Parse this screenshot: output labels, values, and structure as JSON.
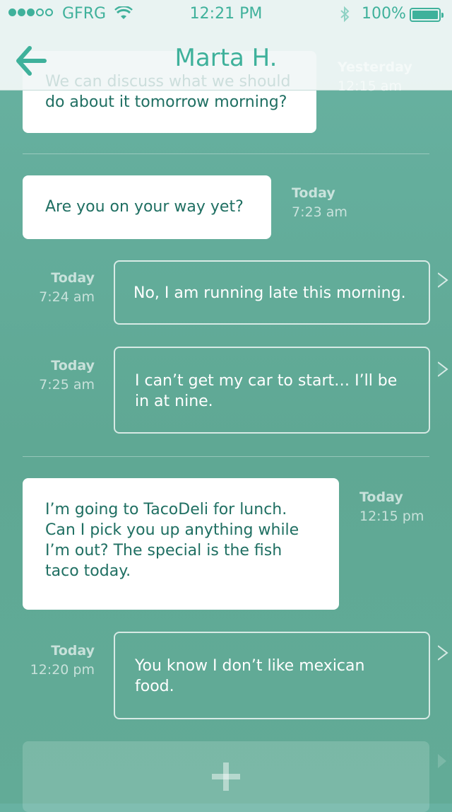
{
  "status_bar": {
    "carrier": "GFRG",
    "time": "12:21 PM",
    "battery": "100%",
    "signal_bars_filled": 3,
    "signal_bars_total": 5
  },
  "header": {
    "title": "Marta H.",
    "back_icon": "back-arrow-icon"
  },
  "colors": {
    "accent": "#3fb19b",
    "background": "#64ad9a",
    "bubble_in": "#ffffff",
    "text_dark": "#1f6f62"
  },
  "messages": [
    {
      "direction": "in",
      "text_line1": "We can discuss what we should",
      "text_line2": "do about it tomorrow morning?",
      "date": "Yesterday",
      "time": "12:15 am"
    },
    {
      "direction": "in",
      "text": "Are you on your way yet?",
      "date": "Today",
      "time": "7:23 am"
    },
    {
      "direction": "out",
      "text": "No, I am running late this morning.",
      "date": "Today",
      "time": "7:24 am"
    },
    {
      "direction": "out",
      "text": "I can’t get my car to start… I’ll be in at nine.",
      "date": "Today",
      "time": "7:25 am"
    },
    {
      "direction": "in",
      "text": "I’m going to TacoDeli for lunch. Can I pick you up anything while I’m out?  The special is the fish taco today.",
      "date": "Today",
      "time": "12:15 pm"
    },
    {
      "direction": "out",
      "text": "You know I don’t like mexican food.",
      "date": "Today",
      "time": "12:20 pm"
    }
  ],
  "compose": {
    "icon": "plus-icon"
  }
}
